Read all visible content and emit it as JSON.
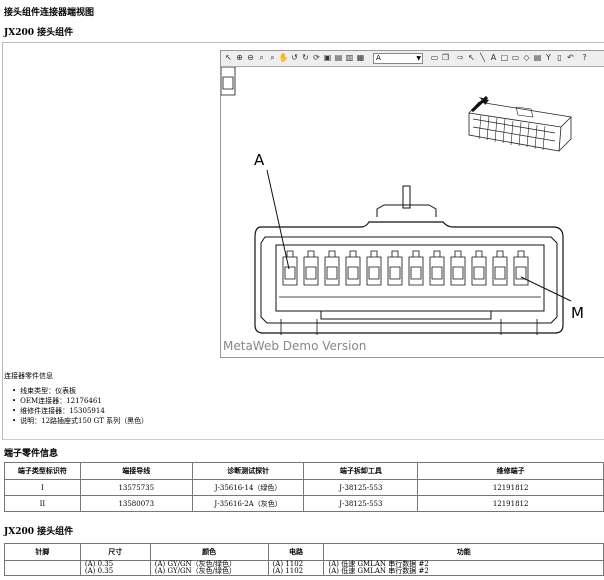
{
  "page_title": "接头组件连接器端视图",
  "section1_title": "JX200 接头组件",
  "viewer": {
    "zoom_select": "A",
    "watermark": "MetaWeb Demo Version",
    "label_a": "A",
    "label_m": "M"
  },
  "connector_info": {
    "title": "连接器零件信息",
    "items": [
      "线束类型：仪表板",
      "OEM连接器：12176461",
      "维修件连接器：15305914",
      "说明：12路插座式150 GT 系列（黑色）"
    ]
  },
  "terminal_title": "端子零件信息",
  "terminal_table": {
    "headers": [
      "端子类型标识符",
      "端接导线",
      "诊断测试探针",
      "端子拆卸工具",
      "维修端子"
    ],
    "rows": [
      [
        "I",
        "13575735",
        "J-35616-14（绿色）",
        "J-38125-553",
        "12191812"
      ],
      [
        "II",
        "13580073",
        "J-35616-2A（灰色）",
        "J-38125-553",
        "12191812"
      ]
    ]
  },
  "section2_title": "JX200 接头组件",
  "pin_table": {
    "headers": [
      "针脚",
      "尺寸",
      "颜色",
      "电路",
      "功能"
    ],
    "row": {
      "size": [
        "(A) 0.35",
        "(A) 0.35"
      ],
      "color": [
        "(A) GY/GN（灰色/绿色）",
        "(A) GY/GN（灰色/绿色）"
      ],
      "circuit": [
        "(A) 1102",
        "(A) 1102"
      ],
      "function": [
        "(A) 低速 GMLAN 串行数据 #2",
        "(A) 低速 GMLAN 串行数据 #2"
      ]
    }
  }
}
